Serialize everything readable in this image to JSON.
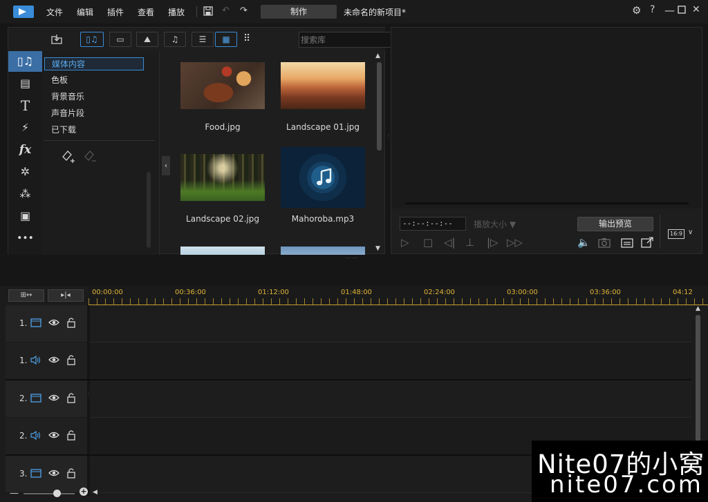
{
  "menu": {
    "file": "文件",
    "edit": "编辑",
    "plugins": "插件",
    "view": "查看",
    "playback": "播放"
  },
  "toolbar": {
    "produce_label": "制作",
    "project_title": "未命名的新项目*"
  },
  "library": {
    "search_placeholder": "搜索库",
    "tree": [
      "媒体内容",
      "色板",
      "背景音乐",
      "声音片段",
      "已下载"
    ],
    "media": [
      {
        "name": "Food.jpg"
      },
      {
        "name": "Landscape 01.jpg"
      },
      {
        "name": "Landscape 02.jpg"
      },
      {
        "name": "Mahoroba.mp3"
      }
    ]
  },
  "preview": {
    "timecode": "--:--:--:--",
    "quality_label": "播放大小 ▼",
    "output_preview_label": "输出预览",
    "aspect_ratio": "16:9"
  },
  "timeline": {
    "ruler": [
      "00:00:00",
      "00:36:00",
      "01:12:00",
      "01:48:00",
      "02:24:00",
      "03:00:00",
      "03:36:00",
      "04:12"
    ],
    "tracks": [
      {
        "number": "1.",
        "kind": "video"
      },
      {
        "number": "1.",
        "kind": "audio"
      },
      {
        "number": "2.",
        "kind": "video"
      },
      {
        "number": "2.",
        "kind": "audio"
      },
      {
        "number": "3.",
        "kind": "video"
      }
    ]
  },
  "watermark": {
    "line1": "Nite07的小窝",
    "line2": "nite07.com"
  },
  "colors": {
    "accent": "#3a8bd8",
    "ruler": "#e0b53a",
    "background": "#161616"
  }
}
